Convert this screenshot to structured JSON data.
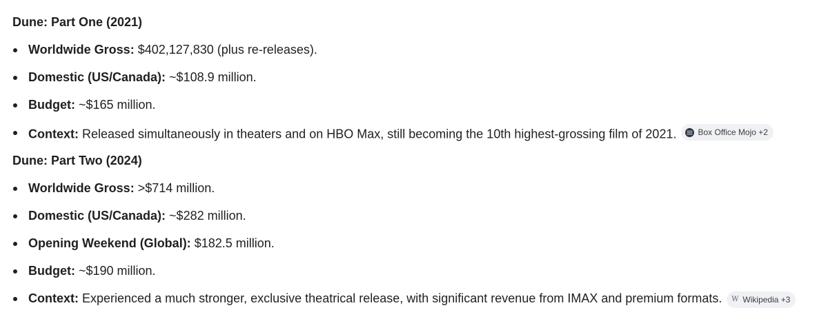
{
  "part_one": {
    "heading": "Dune: Part One (2021)",
    "items": [
      {
        "label": "Worldwide Gross:",
        "text": " $402,127,830 (plus re-releases)."
      },
      {
        "label": "Domestic (US/Canada):",
        "text": " ~$108.9 million."
      },
      {
        "label": "Budget:",
        "text": " ~$165 million."
      },
      {
        "label": "Context:",
        "text": " Released simultaneously in theaters and on HBO Max, still becoming the 10th highest-grossing film of 2021."
      }
    ],
    "source_chip": {
      "label": "Box Office Mojo +2",
      "icon": "box-office-mojo-icon"
    }
  },
  "part_two": {
    "heading": "Dune: Part Two (2024)",
    "items": [
      {
        "label": "Worldwide Gross:",
        "text": " >$714 million."
      },
      {
        "label": "Domestic (US/Canada):",
        "text": " ~$282 million."
      },
      {
        "label": "Opening Weekend (Global):",
        "text": " $182.5 million."
      },
      {
        "label": "Budget:",
        "text": " ~$190 million."
      },
      {
        "label": "Context:",
        "text": " Experienced a much stronger, exclusive theatrical release, with significant revenue from IMAX and premium formats."
      }
    ],
    "source_chip": {
      "label": "Wikipedia +3",
      "icon_glyph": "W",
      "icon": "wikipedia-icon"
    }
  }
}
